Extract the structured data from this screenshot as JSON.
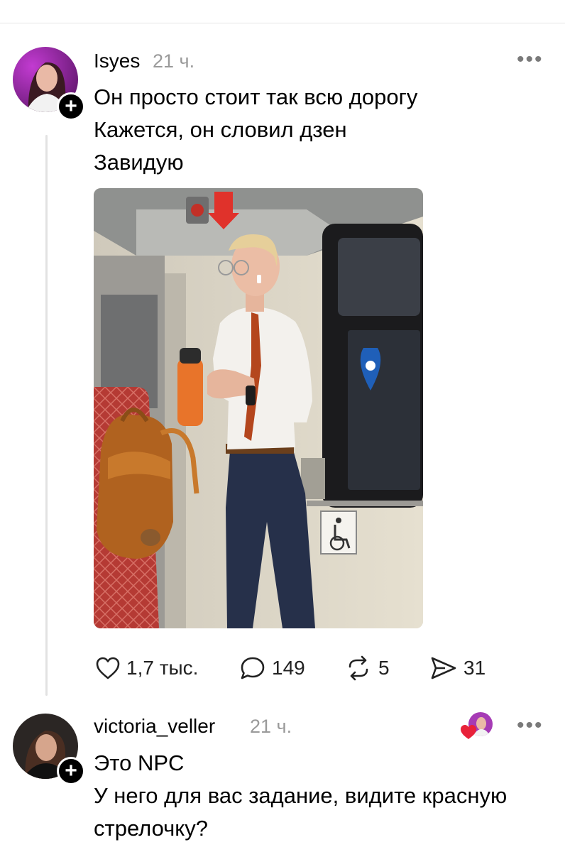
{
  "post": {
    "username": "Isyes",
    "time": "21 ч.",
    "more_label": "•••",
    "follow_label": "+",
    "lines": [
      "Он просто стоит так всю дорогу",
      "Кажется, он словил дзен",
      "Завидую"
    ],
    "actions": {
      "likes": "1,7 тыс.",
      "comments": "149",
      "reposts": "5",
      "shares": "31"
    }
  },
  "reply": {
    "username": "victoria_veller",
    "time": "21 ч.",
    "more_label": "•••",
    "follow_label": "+",
    "lines": [
      "Это NPC",
      "У него для вас задание, видите красную",
      "стрелочку?"
    ]
  },
  "icons": {
    "like": "heart-outline-icon",
    "comment": "speech-bubble-icon",
    "repost": "repost-arrows-icon",
    "share": "paper-plane-icon",
    "liked_by_author": "heart-filled-icon"
  },
  "colors": {
    "text": "#000000",
    "muted": "#9a9a9a",
    "divider": "#e6e6e6",
    "heart": "#e8223a"
  }
}
